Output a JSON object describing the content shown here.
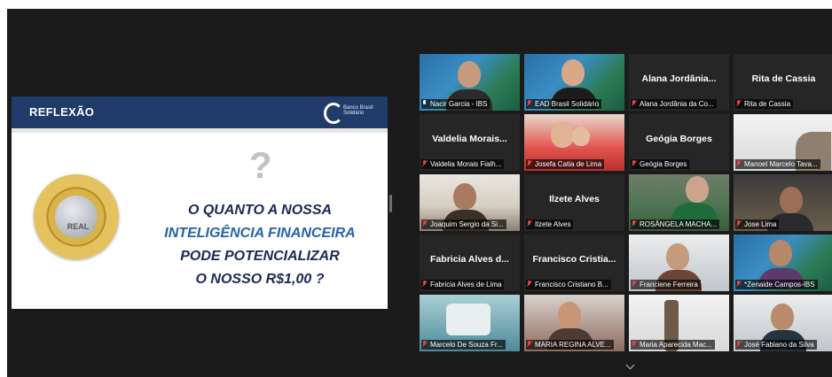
{
  "slide": {
    "header": "REFLEXÃO",
    "logo_text": "Banco Brasil Solidário",
    "coin_label": "REAL",
    "question_mark": "?",
    "lines": [
      "O QUANTO A NOSSA",
      "INTELIGÊNCIA FINANCEIRA",
      "PODE POTENCIALIZAR",
      "O NOSSO R$1,00 ?"
    ],
    "colors": {
      "header_bg": "#1f3b6a",
      "text_dark": "#1a2a55",
      "text_blue": "#2364a8"
    }
  },
  "participants": [
    {
      "title": "",
      "caption": "Nacir Garcia - IBS",
      "muted": false,
      "active": true
    },
    {
      "title": "",
      "caption": "EAD Brasil Solidário",
      "muted": true
    },
    {
      "title": "Alana Jordânia...",
      "caption": "Alana Jordânia da Co...",
      "muted": true
    },
    {
      "title": "Rita de Cassia",
      "caption": "Rita de Cassia",
      "muted": true
    },
    {
      "title": "Valdelia Morais...",
      "caption": "Valdelia Morais Fialh...",
      "muted": true
    },
    {
      "title": "",
      "caption": "Josefa Catia de Lima",
      "muted": true
    },
    {
      "title": "Geógia Borges",
      "caption": "Geógia Borges",
      "muted": true
    },
    {
      "title": "",
      "caption": "Manoel Marcelo Tava...",
      "muted": true
    },
    {
      "title": "",
      "caption": "Joaquim Sergio da Si...",
      "muted": true
    },
    {
      "title": "Ilzete Alves",
      "caption": "Ilzete Alves",
      "muted": true
    },
    {
      "title": "",
      "caption": "ROSÂNGELA MACHA...",
      "muted": true
    },
    {
      "title": "",
      "caption": "Jose Lima",
      "muted": true
    },
    {
      "title": "Fabricia Alves d...",
      "caption": "Fabricia Alves de Lima",
      "muted": true
    },
    {
      "title": "Francisco Cristia...",
      "caption": "Francisco Cristiano B...",
      "muted": true
    },
    {
      "title": "",
      "caption": "Franciene Ferreira",
      "muted": true
    },
    {
      "title": "",
      "caption": "*Zenaide Campos-IBS",
      "muted": true
    },
    {
      "title": "",
      "caption": "Marcelo De Souza Fr...",
      "muted": true
    },
    {
      "title": "",
      "caption": "MARIA REGINA ALVE...",
      "muted": true
    },
    {
      "title": "",
      "caption": "Maria Aparecida Mac...",
      "muted": true
    },
    {
      "title": "",
      "caption": "José Fabiano da Silva",
      "muted": true
    }
  ],
  "icons": {
    "muted": "mic-muted-icon",
    "unmuted": "mic-icon",
    "more": "chevron-down-icon"
  }
}
